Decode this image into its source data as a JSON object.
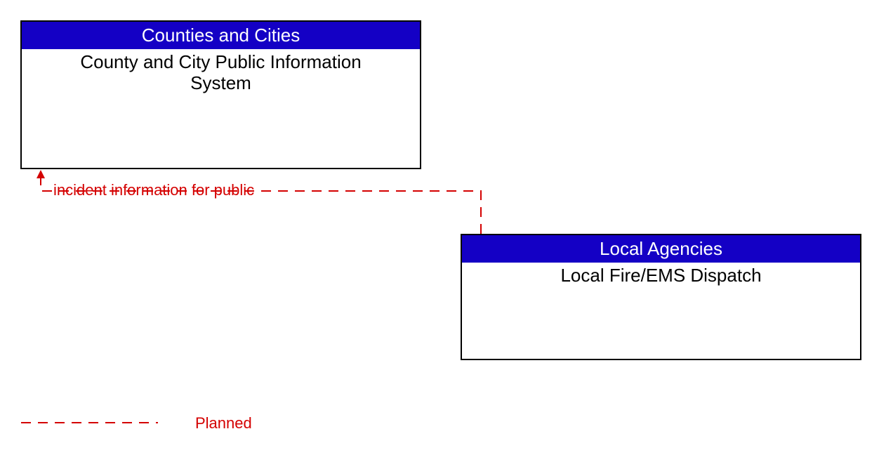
{
  "boxes": {
    "top": {
      "header": "Counties and Cities",
      "body_line1": "County and City Public Information",
      "body_line2": "System"
    },
    "bottom": {
      "header": "Local Agencies",
      "body": "Local Fire/EMS Dispatch"
    }
  },
  "flow": {
    "label": "incident information for public"
  },
  "legend": {
    "planned": "Planned"
  },
  "colors": {
    "header_bg": "#1400c5",
    "planned_line": "#d40000"
  }
}
